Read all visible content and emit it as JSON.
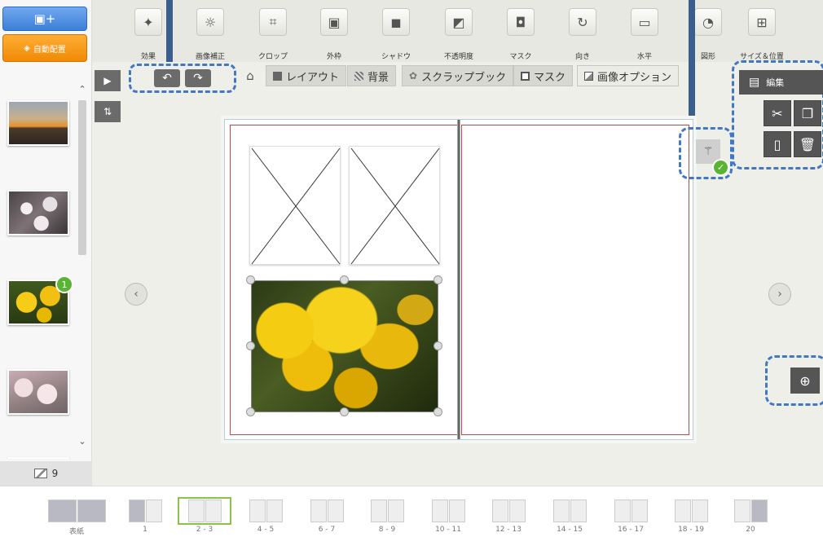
{
  "left_panel": {
    "add_photo_label": "+",
    "auto_place_label": "自動配置",
    "used_badge": "1",
    "photo_count": "9"
  },
  "toolbar": {
    "tools": [
      {
        "icon": "effect-icon",
        "glyph": "✦",
        "label": "効果"
      },
      {
        "icon": "image-correction-icon",
        "glyph": "☼",
        "label": "画像補正"
      },
      {
        "icon": "crop-icon",
        "glyph": "⌗",
        "label": "クロップ"
      },
      {
        "icon": "frame-icon",
        "glyph": "▣",
        "label": "外枠"
      },
      {
        "icon": "shadow-icon",
        "glyph": "◼",
        "label": "シャドウ"
      },
      {
        "icon": "opacity-icon",
        "glyph": "◩",
        "label": "不透明度"
      },
      {
        "icon": "mask-icon",
        "glyph": "◘",
        "label": "マスク"
      },
      {
        "icon": "rotate-icon",
        "glyph": "↻",
        "label": "向き"
      },
      {
        "icon": "level-icon",
        "glyph": "▭",
        "label": "水平"
      },
      {
        "icon": "shape-icon",
        "glyph": "◔",
        "label": "図形"
      },
      {
        "icon": "size-position-icon",
        "glyph": "⊞",
        "label": "サイズ＆位置"
      }
    ]
  },
  "tabs": [
    {
      "label": "レイアウト"
    },
    {
      "label": "背景"
    },
    {
      "label": "スクラップブック"
    },
    {
      "label": "マスク"
    },
    {
      "label": "画像オプション"
    }
  ],
  "edit_panel": {
    "title": "編集"
  },
  "pages": [
    {
      "label": "表紙"
    },
    {
      "label": "1"
    },
    {
      "label": "2 - 3",
      "selected": true
    },
    {
      "label": "4 - 5"
    },
    {
      "label": "6 - 7"
    },
    {
      "label": "8 - 9"
    },
    {
      "label": "10 - 11"
    },
    {
      "label": "12 - 13"
    },
    {
      "label": "14 - 15"
    },
    {
      "label": "16 - 17"
    },
    {
      "label": "18 - 19"
    },
    {
      "label": "20"
    }
  ],
  "colors": {
    "accent_blue": "#4277c4",
    "orange": "#f08a05",
    "green": "#5ab434",
    "trim_red": "#c8484a"
  }
}
